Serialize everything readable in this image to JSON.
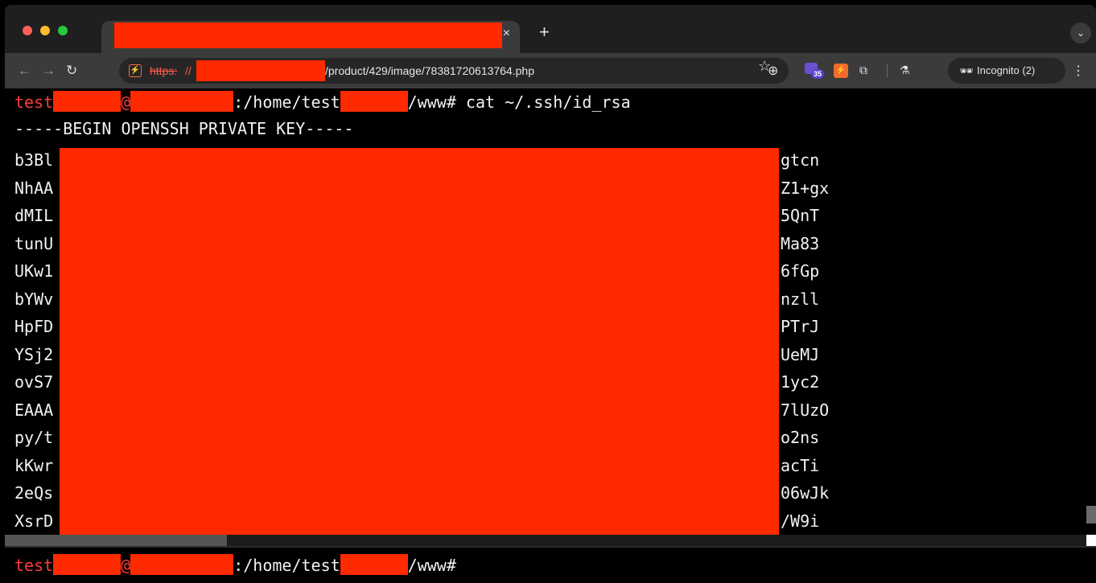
{
  "tab": {
    "close_glyph": "×",
    "new_tab_glyph": "+"
  },
  "address_bar": {
    "scheme": "https:",
    "slashes": "//",
    "path": "/product/429/image/78381720613764.php"
  },
  "extensions": {
    "badge_count": "35"
  },
  "incognito": {
    "label": "Incognito (2)"
  },
  "terminal": {
    "prompt_user": "test",
    "prompt_at": "@",
    "prompt_path_1": ":/home/test",
    "prompt_path_2": "/www#",
    "command": " cat ~/.ssh/id_rsa",
    "begin_line": "-----BEGIN OPENSSH PRIVATE KEY-----",
    "key_lines": [
      {
        "left": "b3Bl",
        "right": "gtcn"
      },
      {
        "left": "NhAA",
        "right": "Z1+gx"
      },
      {
        "left": "dMIL",
        "right": "5QnT"
      },
      {
        "left": "tunU",
        "right": "Ma83"
      },
      {
        "left": "UKw1",
        "right": "6fGp"
      },
      {
        "left": "bYWv",
        "right": "nzll"
      },
      {
        "left": "HpFD",
        "right": "PTrJ"
      },
      {
        "left": "YSj2",
        "right": "UeMJ"
      },
      {
        "left": "ovS7",
        "right": "1yc2"
      },
      {
        "left": "EAAA",
        "right": "7lUzO"
      },
      {
        "left": "py/t",
        "right": "o2ns"
      },
      {
        "left": "kKwr",
        "right": "acTi"
      },
      {
        "left": "2eQs",
        "right": "06wJk"
      },
      {
        "left": "XsrD",
        "right": "/W9i"
      }
    ],
    "final_prompt_path_2": "/www#"
  },
  "colors": {
    "redaction": "#ff2a00",
    "prompt_red": "#ff3b3b",
    "terminal_bg": "#000000",
    "toolbar_bg": "#3b3b3b"
  }
}
